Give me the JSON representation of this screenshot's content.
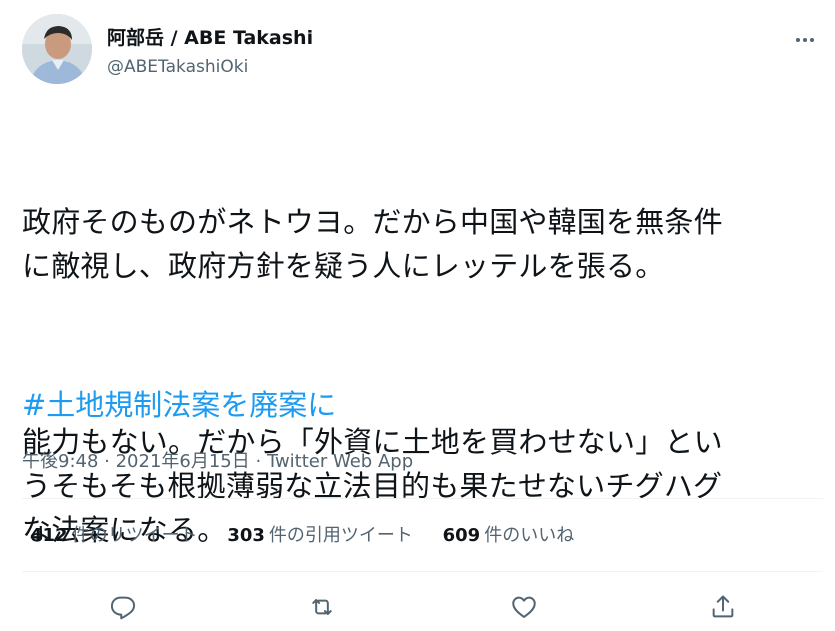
{
  "user": {
    "display_name": "阿部岳 / ABE Takashi",
    "handle": "@ABETakashiOki"
  },
  "tweet": {
    "paragraphs": [
      "政府そのものがネトウヨ。だから中国や韓国を無条件\nに敵視し、政府方針を疑う人にレッテルを張る。",
      "能力もない。だから「外資に土地を買わせない」とい\nうそもそも根拠薄弱な立法目的も果たせないチグハグ\nな法案になる。"
    ],
    "hashtag": "#土地規制法案を廃案に",
    "timestamp": "午後9:48 · 2021年6月15日",
    "separator": " · ",
    "source": "Twitter Web App"
  },
  "stats": [
    {
      "count": "412",
      "label": "件のリツイート"
    },
    {
      "count": "303",
      "label": "件の引用ツイート"
    },
    {
      "count": "609",
      "label": "件のいいね"
    }
  ],
  "colors": {
    "text": "#0f1419",
    "secondary": "#536471",
    "link": "#1d9bf0",
    "divider": "#eff3f4"
  },
  "icons": {
    "more": "more-horizontal-icon",
    "reply": "reply-icon",
    "retweet": "retweet-icon",
    "like": "heart-icon",
    "share": "share-icon"
  }
}
